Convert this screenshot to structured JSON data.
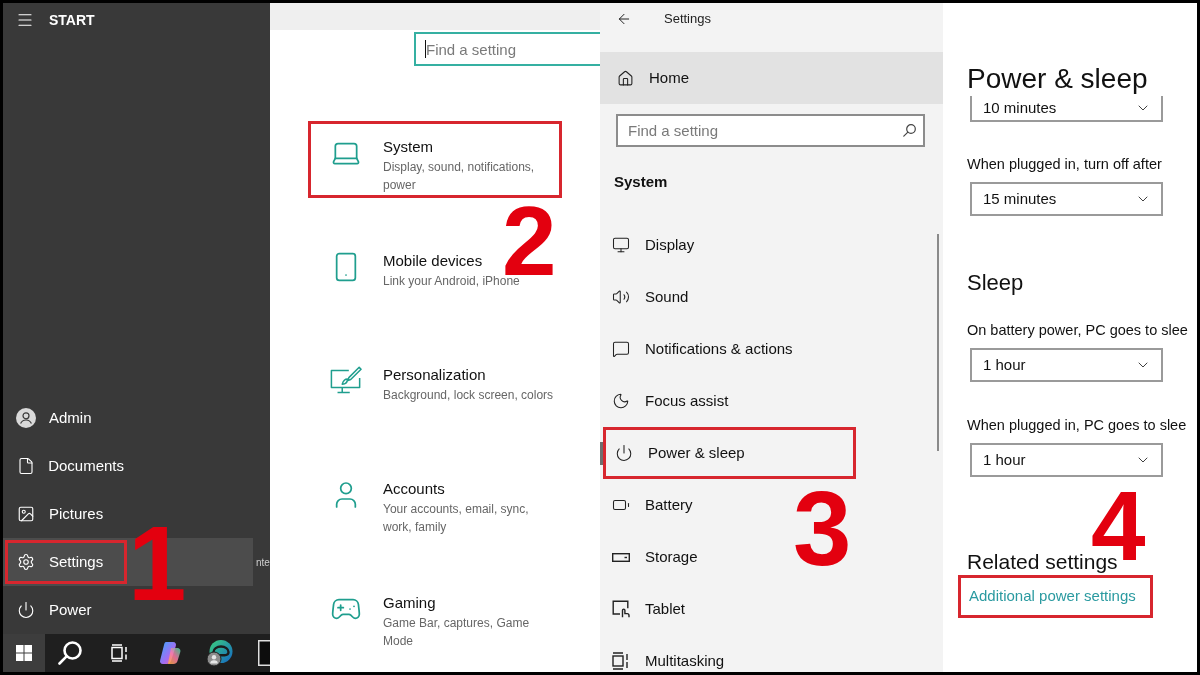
{
  "start_menu": {
    "title": "START",
    "items": [
      {
        "kind": "account",
        "label": "Admin",
        "hovered": false,
        "marked": false
      },
      {
        "kind": "documents",
        "label": "Documents",
        "hovered": false,
        "marked": false
      },
      {
        "kind": "pictures",
        "label": "Pictures",
        "hovered": false,
        "marked": false
      },
      {
        "kind": "settings",
        "label": "Settings",
        "hovered": true,
        "marked": true,
        "trailing_text": "nte"
      },
      {
        "kind": "power",
        "label": "Power",
        "hovered": false,
        "marked": false
      }
    ],
    "step": "1"
  },
  "taskbar": {
    "buttons": [
      {
        "kind": "start",
        "selected": true
      },
      {
        "kind": "search",
        "selected": false
      },
      {
        "kind": "task_view",
        "selected": false
      },
      {
        "kind": "copilot",
        "selected": false
      },
      {
        "kind": "edge",
        "selected": false
      },
      {
        "kind": "app",
        "selected": false
      }
    ]
  },
  "settings_home": {
    "search": {
      "placeholder": "Find a setting",
      "focused": true
    },
    "categories": [
      {
        "kind": "system",
        "title": "System",
        "description": "Display, sound, notifications, power",
        "marked": true
      },
      {
        "kind": "mobile",
        "title": "Mobile devices",
        "description": "Link your Android, iPhone",
        "marked": false
      },
      {
        "kind": "personalization",
        "title": "Personalization",
        "description": "Background, lock screen, colors",
        "marked": false
      },
      {
        "kind": "accounts",
        "title": "Accounts",
        "description": "Your accounts, email, sync, work, family",
        "marked": false
      },
      {
        "kind": "gaming",
        "title": "Gaming",
        "description": "Game Bar, captures, Game Mode",
        "marked": false
      }
    ],
    "step": "2"
  },
  "settings_nav": {
    "title": "Settings",
    "home": {
      "label": "Home",
      "hovered": true
    },
    "search": {
      "placeholder": "Find a setting"
    },
    "section": "System",
    "items": [
      {
        "kind": "display",
        "label": "Display",
        "selected": false,
        "marked": false
      },
      {
        "kind": "sound",
        "label": "Sound",
        "selected": false,
        "marked": false
      },
      {
        "kind": "notifications",
        "label": "Notifications & actions",
        "selected": false,
        "marked": false
      },
      {
        "kind": "focus",
        "label": "Focus assist",
        "selected": false,
        "marked": false
      },
      {
        "kind": "power",
        "label": "Power & sleep",
        "selected": true,
        "marked": true
      },
      {
        "kind": "battery",
        "label": "Battery",
        "selected": false,
        "marked": false
      },
      {
        "kind": "storage",
        "label": "Storage",
        "selected": false,
        "marked": false
      },
      {
        "kind": "tablet",
        "label": "Tablet",
        "selected": false,
        "marked": false
      },
      {
        "kind": "multitasking",
        "label": "Multitasking",
        "selected": false,
        "marked": false
      }
    ],
    "step": "3"
  },
  "power_sleep": {
    "title": "Power & sleep",
    "screen_settings": [
      {
        "value": "10 minutes"
      },
      {
        "label": "When plugged in, turn off after",
        "value": "15 minutes"
      }
    ],
    "sleep_heading": "Sleep",
    "sleep_settings": [
      {
        "label": "On battery power, PC goes to slee",
        "value": "1 hour"
      },
      {
        "label": "When plugged in, PC goes to slee",
        "value": "1 hour"
      }
    ],
    "related_heading": "Related settings",
    "related_links": [
      {
        "label": "Additional power settings",
        "marked": true
      }
    ],
    "step": "4"
  }
}
